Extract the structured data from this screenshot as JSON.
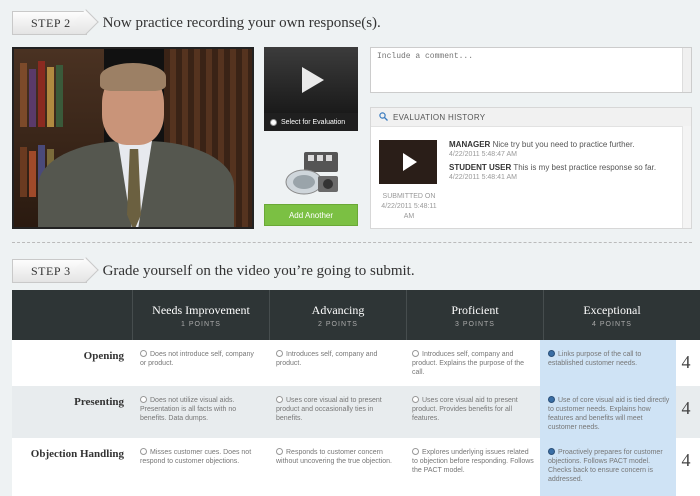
{
  "step2": {
    "label": "STEP 2",
    "title": "Now practice recording your own response(s)."
  },
  "video": {
    "select_label": "Select for Evaluation",
    "add_label": "Add Another"
  },
  "comment": {
    "placeholder": "Include a comment..."
  },
  "evaluation_history": {
    "title": "EVALUATION HISTORY",
    "submitted_label": "SUBMITTED ON",
    "submitted_date": "4/22/2011 5:48:11 AM",
    "entries": [
      {
        "author": "MANAGER",
        "text": "Nice try but you need to practice further.",
        "time": "4/22/2011 5:48:47 AM"
      },
      {
        "author": "STUDENT USER",
        "text": "This is my best practice response so far.",
        "time": "4/22/2011 5:48:41 AM"
      }
    ]
  },
  "step3": {
    "label": "STEP 3",
    "title": "Grade yourself on the video you’re going to submit."
  },
  "rubric": {
    "columns": [
      {
        "name": "Needs Improvement",
        "points": "1 POINTS"
      },
      {
        "name": "Advancing",
        "points": "2 POINTS"
      },
      {
        "name": "Proficient",
        "points": "3 POINTS"
      },
      {
        "name": "Exceptional",
        "points": "4 POINTS"
      }
    ],
    "rows": [
      {
        "name": "Opening",
        "score": "4",
        "cells": [
          "Does not introduce self, company or product.",
          "Introduces self, company and product.",
          "Introduces self, company and product. Explains the purpose of the call.",
          "Links purpose of the call to established customer needs."
        ]
      },
      {
        "name": "Presenting",
        "score": "4",
        "cells": [
          "Does not utilize visual aids. Presentation is all facts with no benefits. Data dumps.",
          "Uses core visual aid to present product and occasionally ties in benefits.",
          "Uses core visual aid to present product. Provides benefits for all features.",
          "Use of core visual aid is tied directly to customer needs. Explains how features and benefits will meet customer needs."
        ]
      },
      {
        "name": "Objection Handling",
        "score": "4",
        "cells": [
          "Misses customer cues. Does not respond to customer objections.",
          "Responds to customer concern without uncovering the true objection.",
          "Explores underlying issues related to objection before responding. Follows the PACT model.",
          "Proactively prepares for customer objections. Follows PACT model. Checks back to ensure concern is addressed."
        ]
      }
    ]
  }
}
